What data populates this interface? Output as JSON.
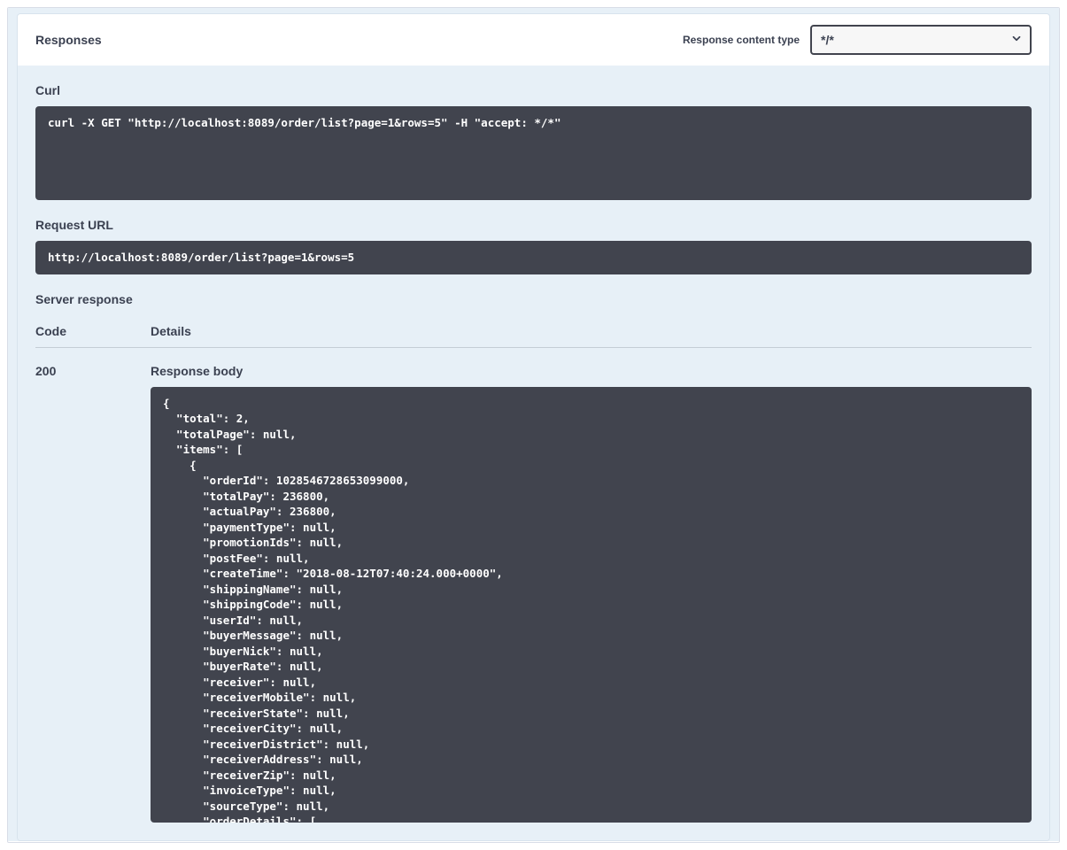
{
  "header": {
    "title": "Responses",
    "content_type_label": "Response content type",
    "content_type_value": "*/*"
  },
  "curl": {
    "label": "Curl",
    "text": "curl -X GET \"http://localhost:8089/order/list?page=1&rows=5\" -H \"accept: */*\""
  },
  "request_url": {
    "label": "Request URL",
    "text": "http://localhost:8089/order/list?page=1&rows=5"
  },
  "server_response_label": "Server response",
  "columns": {
    "code": "Code",
    "details": "Details"
  },
  "response": {
    "code": "200",
    "body_label": "Response body",
    "body_text": "{\n  \"total\": 2,\n  \"totalPage\": null,\n  \"items\": [\n    {\n      \"orderId\": 1028546728653099000,\n      \"totalPay\": 236800,\n      \"actualPay\": 236800,\n      \"paymentType\": null,\n      \"promotionIds\": null,\n      \"postFee\": null,\n      \"createTime\": \"2018-08-12T07:40:24.000+0000\",\n      \"shippingName\": null,\n      \"shippingCode\": null,\n      \"userId\": null,\n      \"buyerMessage\": null,\n      \"buyerNick\": null,\n      \"buyerRate\": null,\n      \"receiver\": null,\n      \"receiverMobile\": null,\n      \"receiverState\": null,\n      \"receiverCity\": null,\n      \"receiverDistrict\": null,\n      \"receiverAddress\": null,\n      \"receiverZip\": null,\n      \"invoiceType\": null,\n      \"sourceType\": null,\n      \"orderDetails\": [\n        {"
  }
}
